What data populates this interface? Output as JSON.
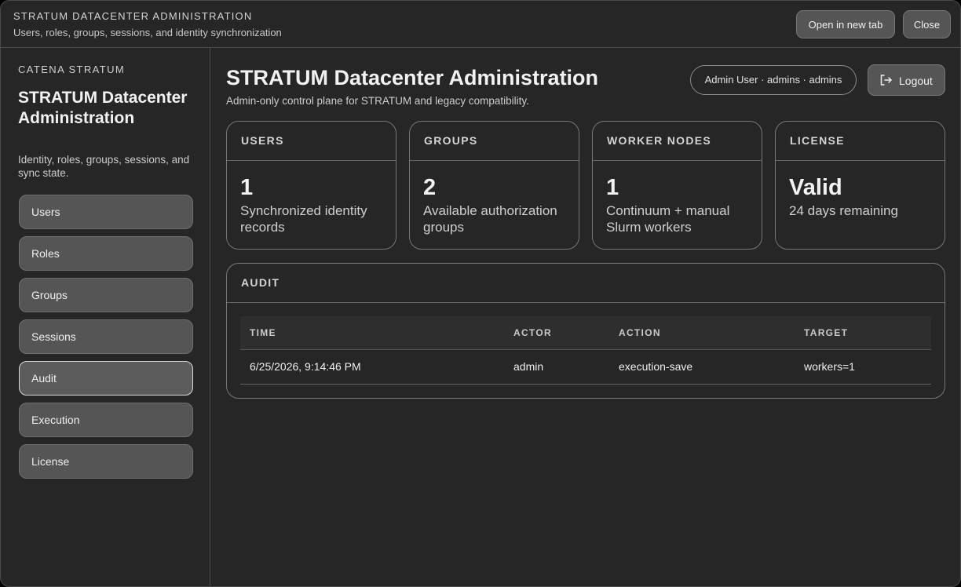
{
  "titlebar": {
    "title": "STRATUM DATACENTER ADMINISTRATION",
    "subtitle": "Users, roles, groups, sessions, and identity synchronization",
    "open_new_tab_label": "Open in new tab",
    "close_label": "Close"
  },
  "sidebar": {
    "brand": "CATENA STRATUM",
    "title": "STRATUM Datacenter Administration",
    "description": "Identity, roles, groups, sessions, and sync state.",
    "active_item": "Audit",
    "items": [
      {
        "label": "Users"
      },
      {
        "label": "Roles"
      },
      {
        "label": "Groups"
      },
      {
        "label": "Sessions"
      },
      {
        "label": "Audit"
      },
      {
        "label": "Execution"
      },
      {
        "label": "License"
      }
    ]
  },
  "header": {
    "title": "STRATUM Datacenter Administration",
    "subtitle": "Admin-only control plane for STRATUM and legacy compatibility.",
    "user_pill": "Admin User · admins · admins",
    "logout_label": "Logout",
    "logout_icon": "logout-icon"
  },
  "cards": [
    {
      "heading": "USERS",
      "value": "1",
      "description": "Synchronized identity records"
    },
    {
      "heading": "GROUPS",
      "value": "2",
      "description": "Available authorization groups"
    },
    {
      "heading": "WORKER NODES",
      "value": "1",
      "description": "Continuum + manual Slurm workers"
    },
    {
      "heading": "LICENSE",
      "value": "Valid",
      "description": "24 days remaining"
    }
  ],
  "audit": {
    "heading": "AUDIT",
    "columns": [
      "TIME",
      "ACTOR",
      "ACTION",
      "TARGET"
    ],
    "rows": [
      {
        "time": "6/25/2026, 9:14:46 PM",
        "actor": "admin",
        "action": "execution-save",
        "target": "workers=1"
      }
    ]
  },
  "colors": {
    "background": "#262626",
    "button": "#555555",
    "border": "#777777",
    "active_border": "#d8d8d8"
  }
}
